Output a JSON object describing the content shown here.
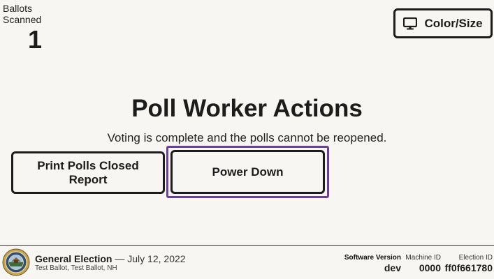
{
  "counter": {
    "label": "Ballots Scanned",
    "value": "1"
  },
  "color_size_button": {
    "label": "Color/Size",
    "icon": "monitor-icon"
  },
  "main": {
    "title": "Poll Worker Actions",
    "subtitle": "Voting is complete and the polls cannot be reopened.",
    "actions": {
      "print_report": "Print Polls Closed Report",
      "power_down": "Power Down"
    }
  },
  "footer": {
    "seal_icon": "state-seal-icon",
    "election_name": "General Election",
    "election_date": "— July 12, 2022",
    "election_place": "Test Ballot, Test Ballot, NH",
    "software_version_label": "Software Version",
    "software_version_value": "dev",
    "machine_id_label": "Machine ID",
    "machine_id_value": "0000",
    "election_id_label": "Election ID",
    "election_id_value": "ff0f661780"
  },
  "colors": {
    "background": "#f7f6f3",
    "text": "#1c1c1c",
    "focus": "#6b3fa0"
  }
}
